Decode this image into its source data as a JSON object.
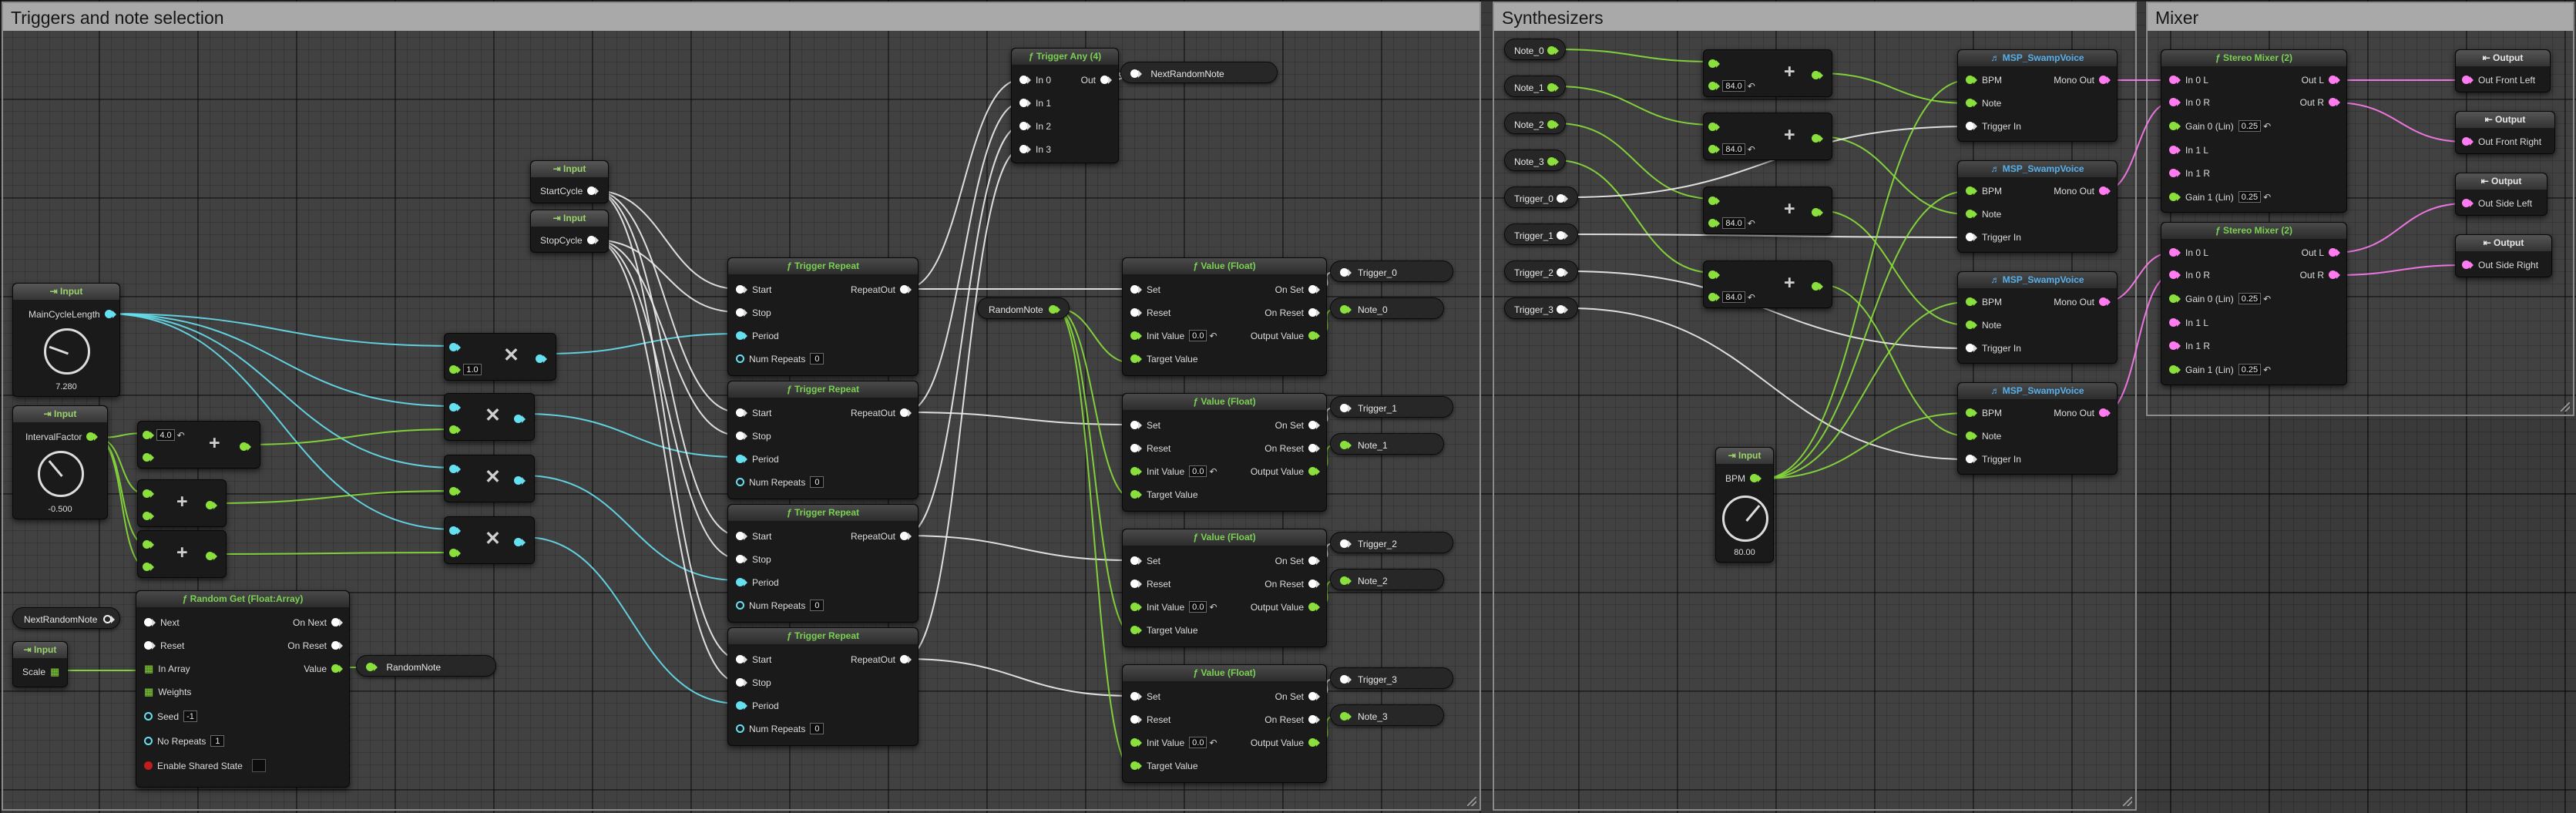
{
  "comments": {
    "triggers": "Triggers and note selection",
    "synths": "Synthesizers",
    "mixer": "Mixer"
  },
  "inputs": {
    "header": "Input",
    "main_cycle_length": {
      "label": "MainCycleLength",
      "value": "7.280"
    },
    "interval_factor": {
      "label": "IntervalFactor",
      "value": "-0.500"
    },
    "start_cycle": "StartCycle",
    "stop_cycle": "StopCycle",
    "scale": "Scale",
    "bpm": {
      "label": "BPM",
      "value": "80.00"
    }
  },
  "math": {
    "mult1_value": "1.0",
    "add1_value": "4.0",
    "synth_add_value": "84.0"
  },
  "trigger_repeat": {
    "title": "Trigger Repeat",
    "start": "Start",
    "stop": "Stop",
    "period": "Period",
    "num_repeats": "Num Repeats",
    "num_repeats_value": "0",
    "repeat_out": "RepeatOut"
  },
  "trigger_any": {
    "title": "Trigger Any (4)",
    "inputs": [
      "In 0",
      "In 1",
      "In 2",
      "In 3"
    ],
    "out": "Out"
  },
  "random_get": {
    "title": "Random Get (Float:Array)",
    "next": "Next",
    "reset": "Reset",
    "in_array": "In Array",
    "weights": "Weights",
    "seed": "Seed",
    "seed_value": "-1",
    "no_repeats": "No Repeats",
    "no_repeats_value": "1",
    "shared": "Enable Shared State",
    "on_next": "On Next",
    "on_reset": "On Reset",
    "value": "Value"
  },
  "value_float": {
    "title": "Value (Float)",
    "set": "Set",
    "reset": "Reset",
    "init_value": "Init Value",
    "init_value_value": "0.0",
    "target_value": "Target Value",
    "on_set": "On Set",
    "on_reset": "On Reset",
    "output_value": "Output Value"
  },
  "pills": {
    "next_random_note": "NextRandomNote",
    "random_note": "RandomNote",
    "trigger": [
      "Trigger_0",
      "Trigger_1",
      "Trigger_2",
      "Trigger_3"
    ],
    "note": [
      "Note_0",
      "Note_1",
      "Note_2",
      "Note_3"
    ]
  },
  "swamp_voice": {
    "title": "MSP_SwampVoice",
    "bpm": "BPM",
    "note": "Note",
    "trigger_in": "Trigger In",
    "mono_out": "Mono Out"
  },
  "stereo_mixer": {
    "title": "Stereo Mixer (2)",
    "in0l": "In 0 L",
    "in0r": "In 0 R",
    "gain0": "Gain 0 (Lin)",
    "in1l": "In 1 L",
    "in1r": "In 1 R",
    "gain1": "Gain 1 (Lin)",
    "gain_value": "0.25",
    "out_l": "Out L",
    "out_r": "Out R"
  },
  "outputs": {
    "header": "Output",
    "labels": [
      "Out Front Left",
      "Out Front Right",
      "Out Side Left",
      "Out Side Right"
    ]
  },
  "colors": {
    "exec_wire": "#f0f0f0",
    "float_wire": "#8adf3c",
    "time_wire": "#66e0f0",
    "audio_wire": "#ff7cf0"
  }
}
